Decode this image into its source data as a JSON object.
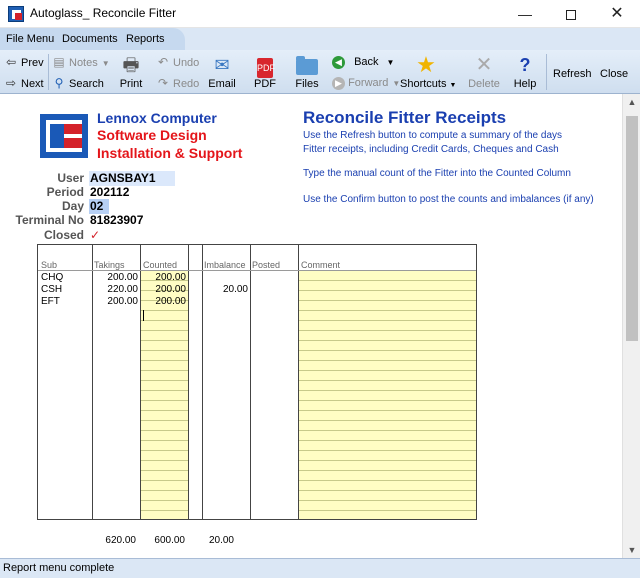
{
  "window": {
    "title": "Autoglass_ Reconcile Fitter",
    "minimize": "—",
    "close": "✕"
  },
  "menu": [
    "File Menu",
    "Documents",
    "Reports"
  ],
  "toolbar": {
    "prev": "Prev",
    "next": "Next",
    "notes": "Notes",
    "search": "Search",
    "print": "Print",
    "undo": "Undo",
    "redo": "Redo",
    "email": "Email",
    "pdf": "PDF",
    "pdf_icon_text": "PDF",
    "files": "Files",
    "back": "Back",
    "forward": "Forward",
    "shortcuts": "Shortcuts",
    "delete": "Delete",
    "help": "Help",
    "refresh": "Refresh",
    "close": "Close"
  },
  "company": {
    "line1": "Lennox Computer",
    "line2": "Software Design",
    "line3": "Installation & Support"
  },
  "heading": "Reconcile Fitter Receipts",
  "instructions": [
    "Use the Refresh button to compute a summary of the days",
    "Fitter receipts, including Credit Cards, Cheques and Cash",
    "Type the manual count of the Fitter into the Counted Column",
    "Use the Confirm button to post the counts and imbalances (if any)"
  ],
  "fields": {
    "user_label": "User",
    "user": "AGNSBAY1",
    "period_label": "Period",
    "period": "202112",
    "day_label": "Day",
    "day": "02",
    "terminal_label": "Terminal No",
    "terminal": "81823907",
    "closed_label": "Closed",
    "closed": "✓"
  },
  "grid": {
    "columns": [
      "Sub",
      "Takings",
      "Counted",
      "Imbalance",
      "Posted",
      "Comment"
    ],
    "rows": [
      {
        "sub": "CHQ",
        "takings": "200.00",
        "counted": "200.00",
        "imbalance": ""
      },
      {
        "sub": "CSH",
        "takings": "220.00",
        "counted": "200.00",
        "imbalance": "20.00"
      },
      {
        "sub": "EFT",
        "takings": "200.00",
        "counted": "200.00",
        "imbalance": ""
      }
    ],
    "totals": {
      "takings": "620.00",
      "counted": "600.00",
      "imbalance": "20.00"
    }
  },
  "status": "Report menu complete",
  "colors": {
    "heading": "#1a3fb0",
    "company_red": "#e4151a",
    "counted_bg": "#fffdc4",
    "menubar": "#dbe7f5"
  }
}
